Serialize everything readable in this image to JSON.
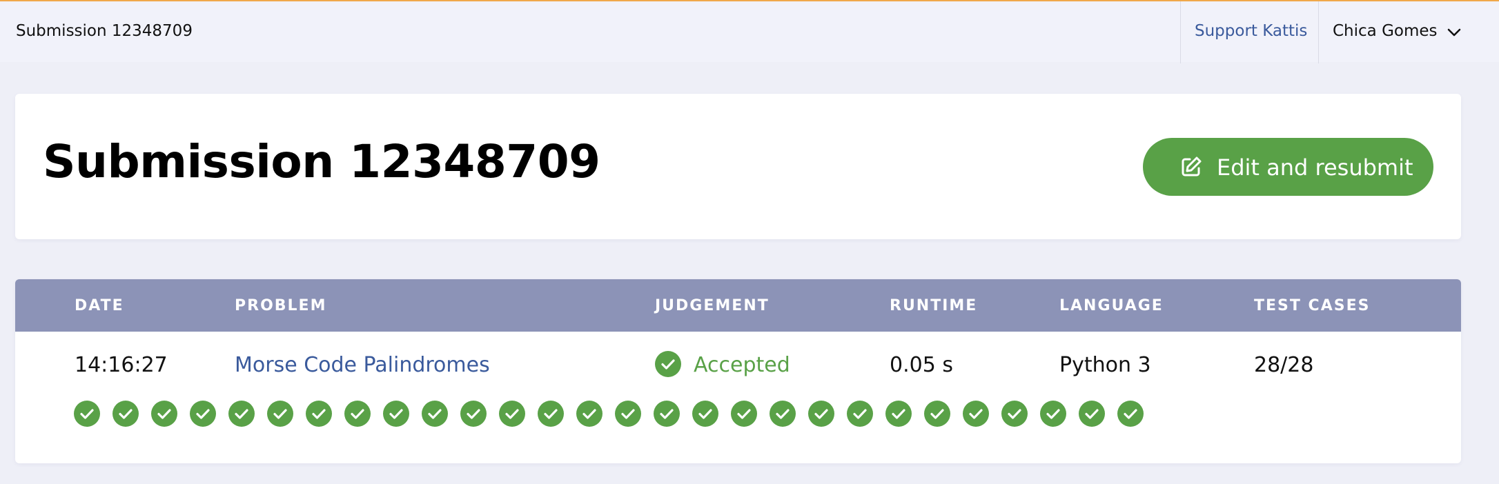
{
  "topbar": {
    "title": "Submission 12348709",
    "support_label": "Support Kattis",
    "user_name": "Chica Gomes"
  },
  "header": {
    "title": "Submission 12348709",
    "resubmit_label": "Edit and resubmit"
  },
  "table": {
    "columns": [
      "DATE",
      "PROBLEM",
      "JUDGEMENT",
      "RUNTIME",
      "LANGUAGE",
      "TEST CASES"
    ],
    "row": {
      "date": "14:16:27",
      "problem": "Morse Code Palindromes",
      "judgement": "Accepted",
      "runtime": "0.05 s",
      "language": "Python 3",
      "test_cases": "28/28"
    },
    "test_case_results": [
      "accepted",
      "accepted",
      "accepted",
      "accepted",
      "accepted",
      "accepted",
      "accepted",
      "accepted",
      "accepted",
      "accepted",
      "accepted",
      "accepted",
      "accepted",
      "accepted",
      "accepted",
      "accepted",
      "accepted",
      "accepted",
      "accepted",
      "accepted",
      "accepted",
      "accepted",
      "accepted",
      "accepted",
      "accepted",
      "accepted",
      "accepted",
      "accepted"
    ]
  },
  "colors": {
    "accent_orange": "#f0a84a",
    "success_green": "#59a147",
    "table_header": "#8c93b7",
    "link_blue": "#3a5a9c",
    "background": "#eeeff7"
  },
  "icons": {
    "chevron": "chevron-down-icon",
    "edit": "edit-icon",
    "check": "check-circle-icon"
  }
}
